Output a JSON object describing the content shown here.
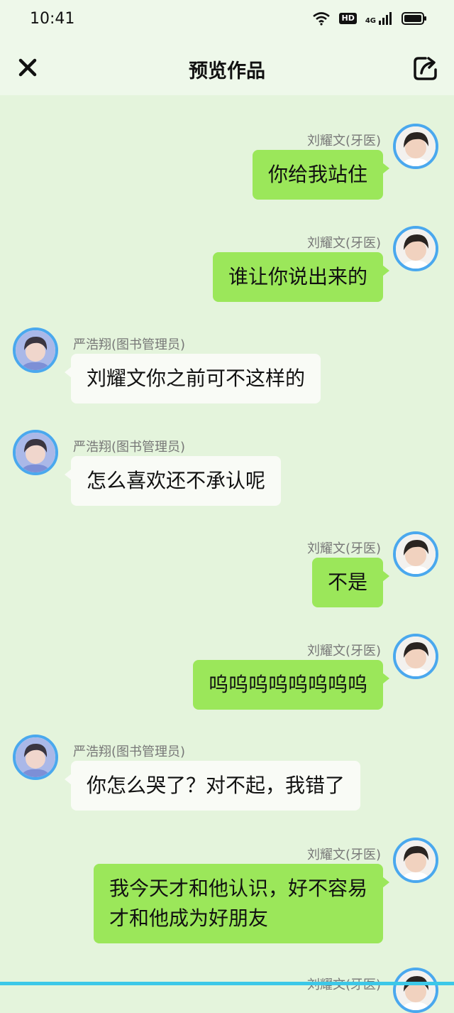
{
  "status_bar": {
    "time": "10:41",
    "network": "4G",
    "hd": "HD"
  },
  "header": {
    "title": "预览作品"
  },
  "messages": [
    {
      "side": "right",
      "sender": "刘耀文(牙医)",
      "text": "你给我站住"
    },
    {
      "side": "right",
      "sender": "刘耀文(牙医)",
      "text": "谁让你说出来的"
    },
    {
      "side": "left",
      "sender": "严浩翔(图书管理员)",
      "text": "刘耀文你之前可不这样的"
    },
    {
      "side": "left",
      "sender": "严浩翔(图书管理员)",
      "text": "怎么喜欢还不承认呢"
    },
    {
      "side": "right",
      "sender": "刘耀文(牙医)",
      "text": "不是"
    },
    {
      "side": "right",
      "sender": "刘耀文(牙医)",
      "text": "呜呜呜呜呜呜呜呜"
    },
    {
      "side": "left",
      "sender": "严浩翔(图书管理员)",
      "text": "你怎么哭了？对不起，我错了"
    },
    {
      "side": "right",
      "sender": "刘耀文(牙医)",
      "text": "我今天才和他认识，好不容易\n才和他成为好朋友"
    },
    {
      "side": "right",
      "sender": "刘耀文(牙医)",
      "text": ""
    }
  ],
  "colors": {
    "background": "#e4f4dc",
    "header_bg": "#eef8ea",
    "sent_bubble": "#9be75a",
    "received_bubble": "#f9fbf6",
    "avatar_border": "#4aa8ee"
  }
}
